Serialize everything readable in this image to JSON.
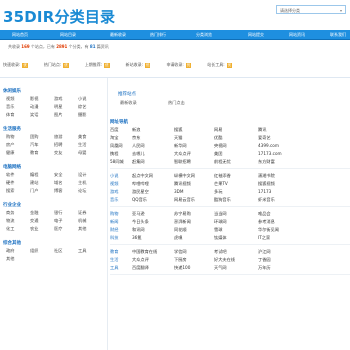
{
  "site": {
    "logo": "35DIR分类目录",
    "search_placeholder": "请选择分类",
    "search_caret": "▾"
  },
  "nav": [
    "网站首页",
    "网站目录",
    "最新收录",
    "热门排行",
    "分类浏览",
    "网站提交",
    "网站资讯",
    "联系我们"
  ],
  "stats": {
    "prefix": "共收录",
    "sites": "169",
    "mid": "个站点，已有",
    "cats": "2891",
    "mid2": "个分类，有",
    "extra": "81",
    "suffix": "篇资讯"
  },
  "quick": [
    {
      "label": "快速收录:",
      "badge": "优"
    },
    {
      "label": "热门站点:",
      "badge": "优"
    },
    {
      "label": "上期推荐:",
      "badge": "优"
    },
    {
      "label": "新站收录:",
      "badge": "优"
    },
    {
      "label": "申请收录:",
      "badge": "优"
    },
    {
      "label": "站长工具:",
      "badge": "优"
    }
  ],
  "sidebar": {
    "groups": [
      {
        "title": "休闲娱乐",
        "items": [
          "视频",
          "影视",
          "游戏",
          "小说",
          "音乐",
          "动漫",
          "明星",
          "综艺",
          "体育",
          "笑话",
          "图片",
          "摄影"
        ]
      },
      {
        "title": "生活服务",
        "items": [
          "购物",
          "团购",
          "旅游",
          "美食",
          "房产",
          "汽车",
          "招聘",
          "生活",
          "健康",
          "教育",
          "交友",
          "母婴"
        ]
      },
      {
        "title": "电脑网络",
        "items": [
          "软件",
          "编程",
          "安全",
          "设计",
          "硬件",
          "建站",
          "域名",
          "主机",
          "搜索",
          "门户",
          "博客",
          "论坛"
        ]
      },
      {
        "title": "行业企业",
        "items": [
          "商务",
          "金融",
          "银行",
          "证券",
          "物流",
          "交通",
          "电子",
          "机械",
          "化工",
          "农业",
          "医疗",
          "其他"
        ]
      },
      {
        "title": "综合其他",
        "items": [
          "政府",
          "组织",
          "社区",
          "工具",
          "其他"
        ]
      }
    ]
  },
  "main": {
    "tab_header": "推荐站点",
    "tabs": [
      "最新收录",
      "热门点击"
    ],
    "sections": [
      {
        "title": "网址导航",
        "rows": [
          [
            "百度",
            "新浪",
            "搜狐",
            "网易",
            "腾讯"
          ],
          [
            "淘宝",
            "京东",
            "天猫",
            "优酷",
            "爱奇艺"
          ],
          [
            "凤凰网",
            "人民网",
            "新华网",
            "央视网",
            "4399.com"
          ],
          [
            "携程",
            "去哪儿",
            "大众点评",
            "美团",
            "17173.com"
          ],
          [
            "58同城",
            "赶集网",
            "智联招聘",
            "前程无忧",
            "东方财富"
          ]
        ]
      },
      {
        "title": "",
        "rows": [
          [
            "小说",
            "起点中文网",
            "纵横中文网",
            "红袖添香",
            "潇湘书院"
          ],
          [
            "视频",
            "哔哩哔哩",
            "腾讯视频",
            "芒果TV",
            "搜狐视频"
          ],
          [
            "游戏",
            "游民星空",
            "3DM",
            "多玩",
            "17173"
          ],
          [
            "音乐",
            "QQ音乐",
            "网易云音乐",
            "酷狗音乐",
            "虾米音乐"
          ]
        ]
      },
      {
        "title": "",
        "rows": [
          [
            "购物",
            "亚马逊",
            "苏宁易购",
            "当当网",
            "唯品会"
          ],
          [
            "新闻",
            "今日头条",
            "澎湃新闻",
            "环球网",
            "参考消息"
          ],
          [
            "财经",
            "和讯网",
            "同花顺",
            "雪球",
            "华尔街见闻"
          ],
          [
            "科技",
            "36氪",
            "虎嗅",
            "钛媒体",
            "IT之家"
          ]
        ]
      },
      {
        "title": "",
        "rows": [
          [
            "教育",
            "中国教育在线",
            "学信网",
            "考试吧",
            "沪江网"
          ],
          [
            "生活",
            "大众点评",
            "下厨房",
            "好大夫在线",
            "丁香园"
          ],
          [
            "工具",
            "百度翻译",
            "快递100",
            "天气网",
            "万年历"
          ]
        ]
      }
    ]
  }
}
